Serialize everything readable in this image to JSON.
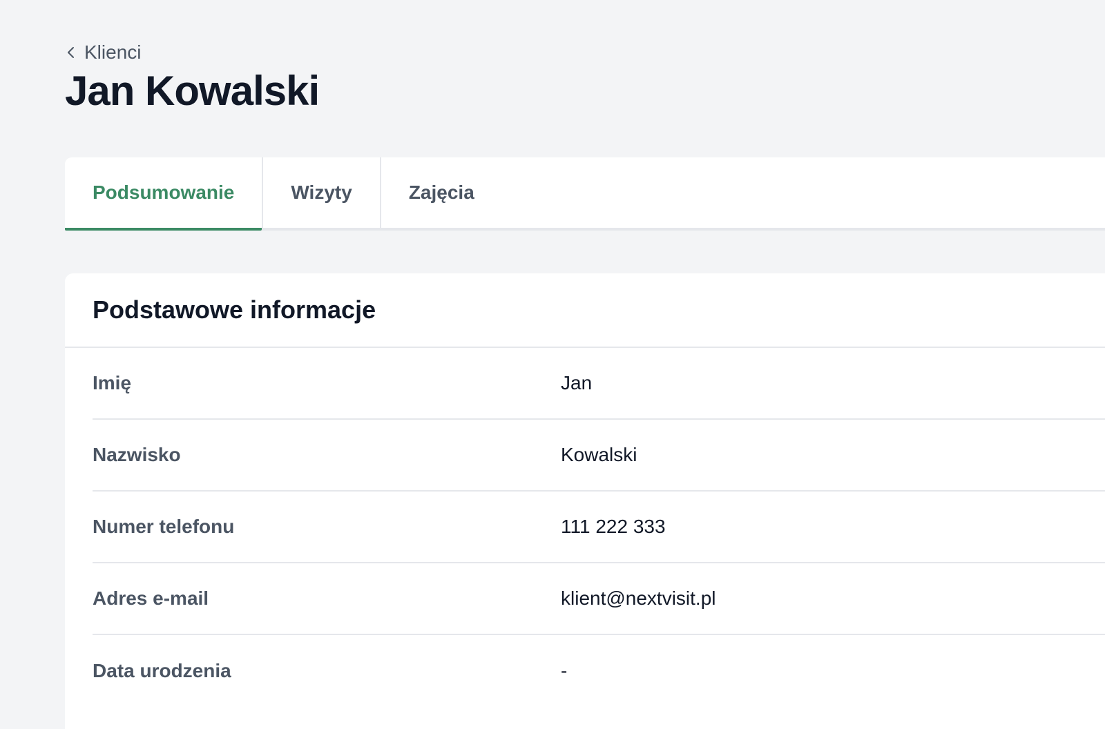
{
  "breadcrumb": {
    "label": "Klienci",
    "icon": "chevron-left-icon"
  },
  "page": {
    "title": "Jan Kowalski"
  },
  "tabs": [
    {
      "label": "Podsumowanie",
      "active": true
    },
    {
      "label": "Wizyty",
      "active": false
    },
    {
      "label": "Zajęcia",
      "active": false
    }
  ],
  "card": {
    "title": "Podstawowe informacje",
    "rows": [
      {
        "label": "Imię",
        "value": "Jan"
      },
      {
        "label": "Nazwisko",
        "value": "Kowalski"
      },
      {
        "label": "Numer telefonu",
        "value": "111 222 333"
      },
      {
        "label": "Adres e-mail",
        "value": "klient@nextvisit.pl"
      },
      {
        "label": "Data urodzenia",
        "value": "-"
      }
    ]
  },
  "colors": {
    "accent": "#3b8a64",
    "background": "#f3f4f6",
    "text": "#111827",
    "muted": "#4b5563",
    "border": "#e5e7eb"
  }
}
